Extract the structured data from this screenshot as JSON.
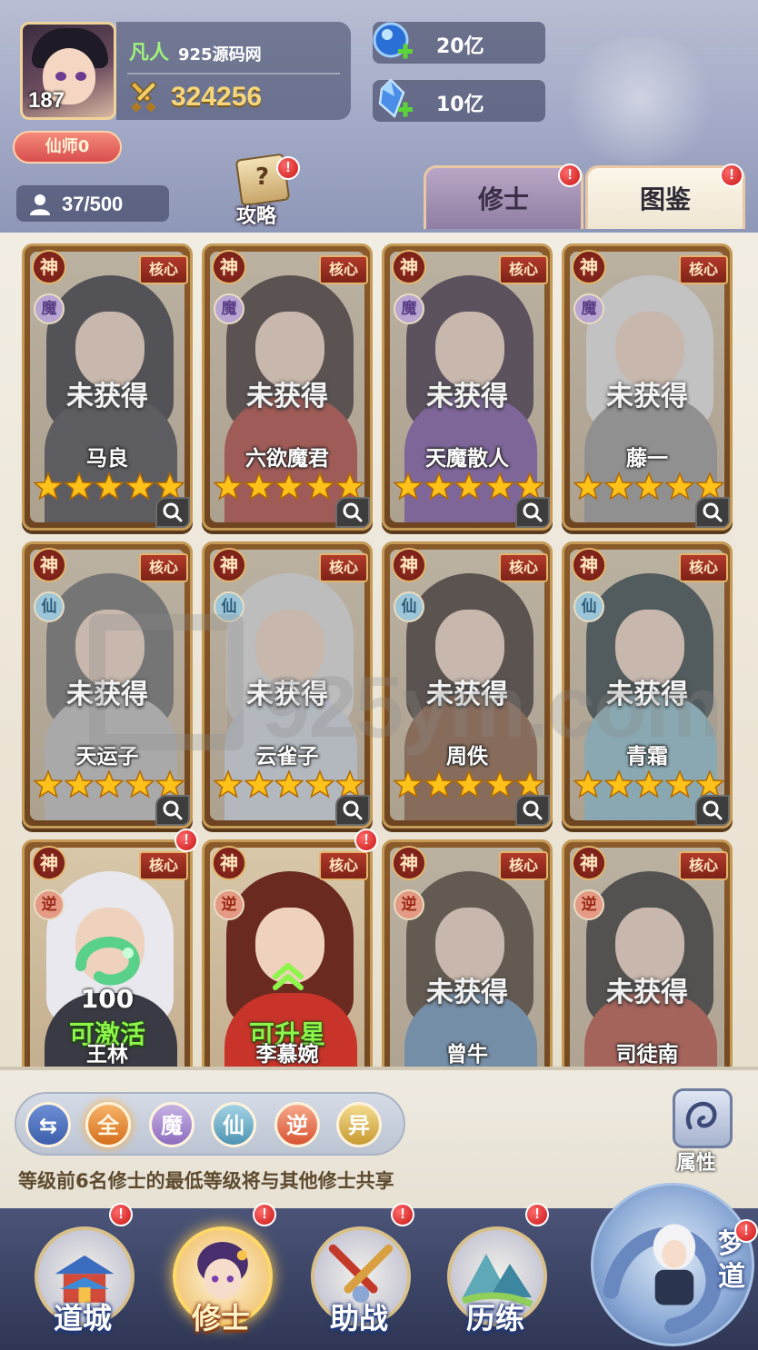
{
  "player": {
    "level": "187",
    "rank": "凡人",
    "server": "925源码网",
    "power": "324256",
    "title_badge": "仙师0",
    "members": "37/500"
  },
  "resources": [
    {
      "icon": "blue-orb-plus-icon",
      "value": "20亿"
    },
    {
      "icon": "crystal-plus-icon",
      "value": "10亿"
    }
  ],
  "strategy": {
    "label": "攻略",
    "icon": "scroll-question-icon",
    "alert": "!"
  },
  "tabs": [
    {
      "label": "修士",
      "alert": "!"
    },
    {
      "label": "图鉴",
      "alert": "!",
      "active": true
    }
  ],
  "card_badges": {
    "tier": "神",
    "core": "核心"
  },
  "cards": [
    {
      "name": "马良",
      "faction": "魔",
      "status": "未获得",
      "stars": 5
    },
    {
      "name": "六欲魔君",
      "faction": "魔",
      "status": "未获得",
      "stars": 5
    },
    {
      "name": "天魔散人",
      "faction": "魔",
      "status": "未获得",
      "stars": 5
    },
    {
      "name": "藤一",
      "faction": "魔",
      "status": "未获得",
      "stars": 5
    },
    {
      "name": "天运子",
      "faction": "仙",
      "status": "未获得",
      "stars": 5
    },
    {
      "name": "云雀子",
      "faction": "仙",
      "status": "未获得",
      "stars": 5
    },
    {
      "name": "周佚",
      "faction": "仙",
      "status": "未获得",
      "stars": 5
    },
    {
      "name": "青霜",
      "faction": "仙",
      "status": "未获得",
      "stars": 5
    },
    {
      "name": "王林",
      "faction": "逆",
      "status": "可激活",
      "count": "100",
      "alert": "!"
    },
    {
      "name": "李慕婉",
      "faction": "逆",
      "status": "可升星",
      "alert": "!"
    },
    {
      "name": "曾牛",
      "faction": "逆",
      "status": "未获得"
    },
    {
      "name": "司徒南",
      "faction": "逆",
      "status": "未获得"
    }
  ],
  "watermark": "925ym.com",
  "filters": {
    "swap_icon": "swap-arrows-icon",
    "all": "全",
    "mo": "魔",
    "xian": "仙",
    "ni": "逆",
    "yi": "异"
  },
  "attribute_button": {
    "label": "属性"
  },
  "info_text": "等级前6名修士的最低等级将与其他修士共享",
  "nav": [
    {
      "label": "道城",
      "alert": "!"
    },
    {
      "label": "修士",
      "alert": "!",
      "active": true
    },
    {
      "label": "助战",
      "alert": "!"
    },
    {
      "label": "历练",
      "alert": "!"
    }
  ],
  "dream_path": {
    "label": "梦道",
    "alert": "!"
  },
  "colors": {
    "card_frame": "#c49a56",
    "gold_star": "#ffc21a",
    "green_status": "#8df54a",
    "alert_red": "#d91c1c"
  }
}
